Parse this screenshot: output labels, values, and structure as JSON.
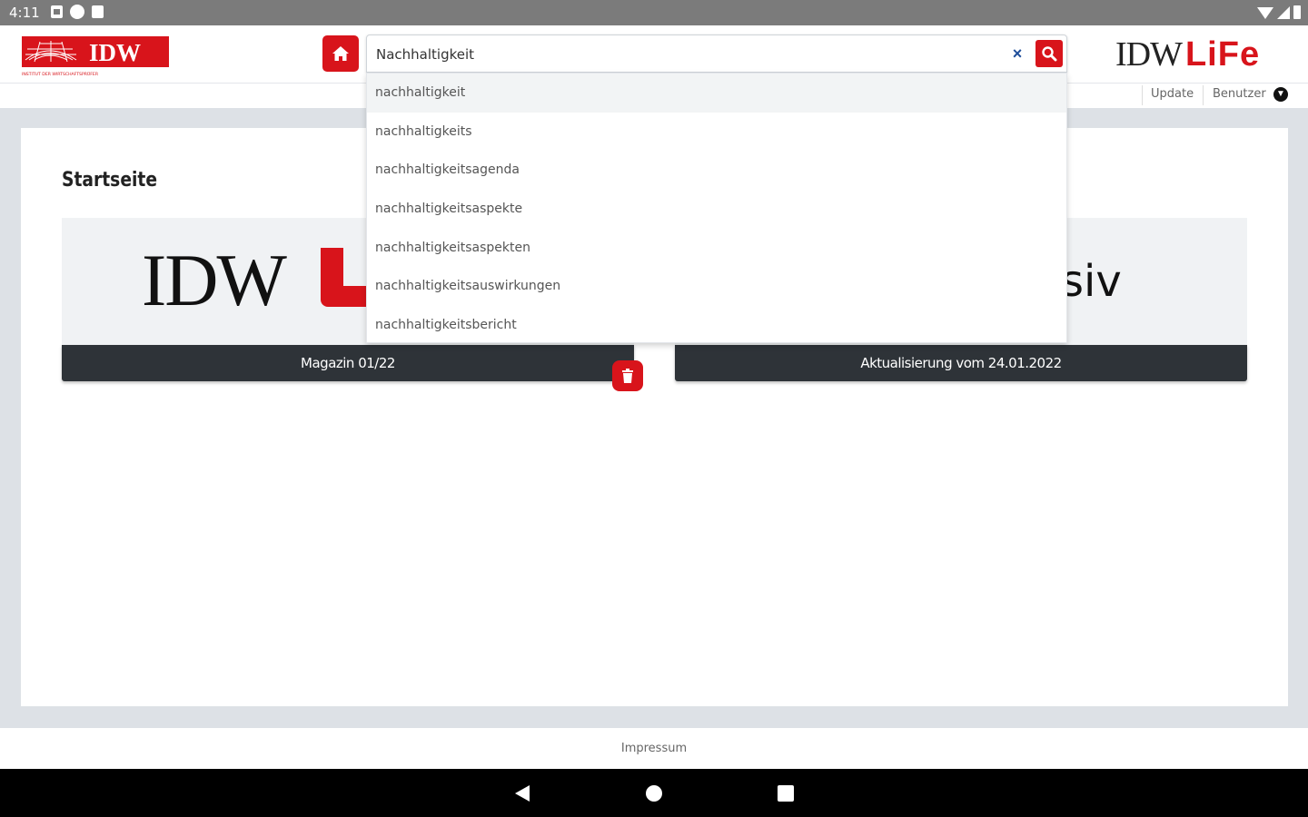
{
  "status_bar": {
    "time": "4:11"
  },
  "header": {
    "logo_text": "IDW",
    "logo_tagline": "INSTITUT DER WIRTSCHAFTSPRÜFER",
    "brand_idw": "IDW",
    "brand_life": "LiFe"
  },
  "search": {
    "value": "Nachhaltigkeit",
    "clear_label": "×"
  },
  "subbar": {
    "update_label": "Update",
    "user_label": "Benutzer"
  },
  "main": {
    "page_title": "Startseite",
    "tiles": [
      {
        "image_text": "IDW",
        "caption": "Magazin 01/22"
      },
      {
        "image_text": "siv",
        "caption": "Aktualisierung vom 24.01.2022"
      }
    ]
  },
  "suggestions": [
    "nachhaltigkeit",
    "nachhaltigkeits",
    "nachhaltigkeitsagenda",
    "nachhaltigkeitsaspekte",
    "nachhaltigkeitsaspekten",
    "nachhaltigkeitsauswirkungen",
    "nachhaltigkeitsbericht"
  ],
  "footer": {
    "impressum_label": "Impressum"
  },
  "colors": {
    "brand_red": "#d8141b",
    "caption_dark": "#2e3338"
  },
  "icons": [
    "home-icon",
    "search-icon",
    "close-icon",
    "trash-icon",
    "chevron-down-icon",
    "back-icon",
    "nav-home-icon",
    "recents-icon"
  ]
}
